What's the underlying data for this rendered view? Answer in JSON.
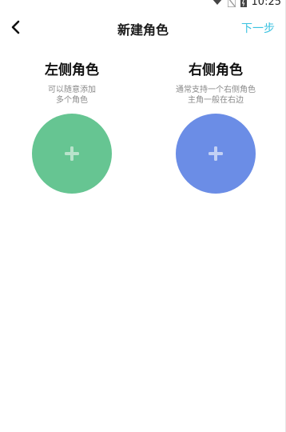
{
  "status_bar": {
    "time": "10:25"
  },
  "nav": {
    "title": "新建角色",
    "next_label": "下一步"
  },
  "left_role": {
    "title": "左侧角色",
    "desc_line1": "可以随意添加",
    "desc_line2": "多个角色",
    "circle_color": "#66c592"
  },
  "right_role": {
    "title": "右侧角色",
    "desc_line1": "通常支持一个右侧角色",
    "desc_line2": "主角一般在右边",
    "circle_color": "#6b8de6"
  },
  "icons": {
    "back": "chevron-left-icon",
    "add": "plus-icon",
    "status": [
      "wifi-icon",
      "no-sim-icon",
      "battery-icon"
    ]
  }
}
